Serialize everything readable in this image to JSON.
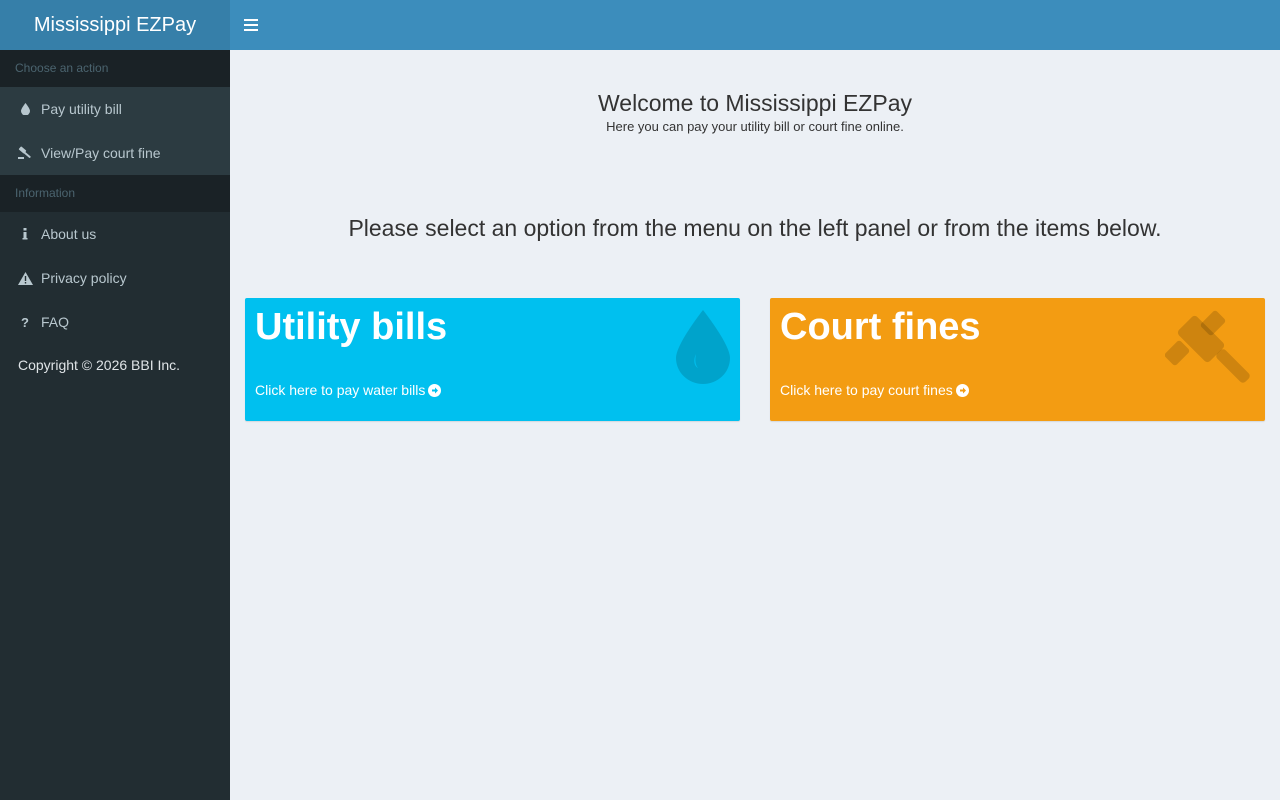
{
  "header": {
    "logo_text": "Mississippi EZPay"
  },
  "sidebar": {
    "sections": [
      {
        "header": "Choose an action",
        "items": [
          {
            "label": "Pay utility bill",
            "icon": "tint-icon"
          },
          {
            "label": "View/Pay court fine",
            "icon": "gavel-icon"
          }
        ]
      },
      {
        "header": "Information",
        "items": [
          {
            "label": "About us",
            "icon": "info-icon"
          },
          {
            "label": "Privacy policy",
            "icon": "warning-icon"
          },
          {
            "label": "FAQ",
            "icon": "question-icon"
          }
        ]
      }
    ],
    "copyright": "Copyright © 2026 BBI Inc."
  },
  "main": {
    "welcome_title": "Welcome to Mississippi EZPay",
    "welcome_subtitle": "Here you can pay your utility bill or court fine online.",
    "instructions": "Please select an option from the menu on the left panel or from the items below.",
    "boxes": [
      {
        "title": "Utility bills",
        "link": "Click here to pay water bills",
        "color": "#00c0ef",
        "icon": "tint-icon"
      },
      {
        "title": "Court fines",
        "link": "Click here to pay court fines",
        "color": "#f39c12",
        "icon": "gavel-icon"
      }
    ]
  },
  "colors": {
    "navbar": "#3c8dbc",
    "logo_bg": "#367fa9",
    "sidebar_bg": "#222d32",
    "sidebar_header_bg": "#1a2226",
    "content_bg": "#ecf0f5"
  }
}
